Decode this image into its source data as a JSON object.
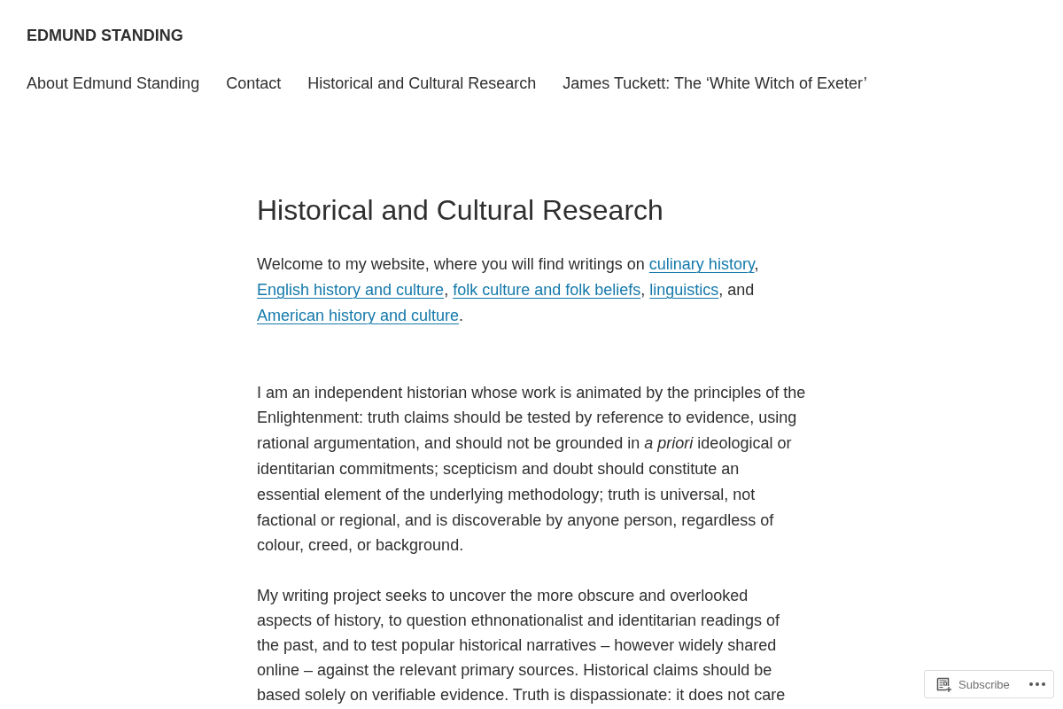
{
  "header": {
    "site_title": "EDMUND STANDING",
    "nav": [
      "About Edmund Standing",
      "Contact",
      "Historical and Cultural Research",
      "James Tuckett: The ‘White Witch of Exeter’"
    ]
  },
  "article": {
    "title": "Historical and Cultural Research",
    "intro": [
      {
        "kind": "text",
        "text": "Welcome to my website, where you will find writings on "
      },
      {
        "kind": "link",
        "text": "culinary history"
      },
      {
        "kind": "text",
        "text": ", "
      },
      {
        "kind": "link",
        "text": "English history and culture"
      },
      {
        "kind": "text",
        "text": ", "
      },
      {
        "kind": "link",
        "text": "folk culture and folk beliefs"
      },
      {
        "kind": "text",
        "text": ", "
      },
      {
        "kind": "link",
        "text": "linguistics"
      },
      {
        "kind": "text",
        "text": ", and "
      },
      {
        "kind": "link",
        "text": "American history and culture"
      },
      {
        "kind": "text",
        "text": "."
      }
    ],
    "paragraphs": [
      "I am an independent historian whose work is animated by the principles of the Enlightenment: truth claims should be tested by reference to evidence, using rational argumentation, and should not be grounded in *a priori* ideological or identitarian commitments; scepticism and doubt should constitute an essential element of the underlying methodology; truth is universal, not factional or regional, and is discoverable by anyone person, regardless of colour, creed, or background.",
      "My writing project seeks to uncover the more obscure and overlooked aspects of history, to question ethnonationalist and identitarian readings of the past, and to test popular historical narratives – however widely shared online – against the relevant primary sources. Historical claims should be based solely on verifiable evidence. Truth is dispassionate: it does not care"
    ]
  },
  "subscribe_bar": {
    "label": "Subscribe"
  }
}
